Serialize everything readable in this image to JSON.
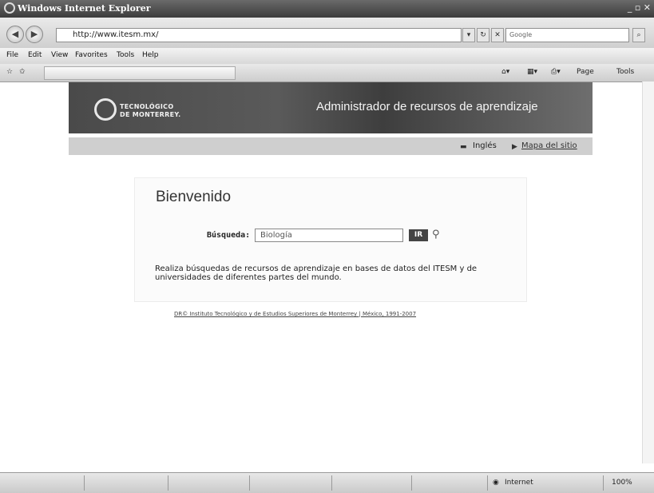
{
  "window": {
    "title": "Windows Internet Explorer"
  },
  "address": {
    "url": "http://www.itesm.mx/",
    "search_placeholder": "Google"
  },
  "menu": [
    "File",
    "Edit",
    "View",
    "Favorites",
    "Tools",
    "Help"
  ],
  "commandbar": {
    "page": "Page",
    "tools": "Tools"
  },
  "banner": {
    "logo_line1": "TECNOLÓGICO",
    "logo_line2": "DE MONTERREY.",
    "title": "Administrador de recursos de aprendizaje"
  },
  "subnav": {
    "ingles": "Inglés",
    "sitemap": "Mapa del sitio"
  },
  "main": {
    "heading": "Bienvenido",
    "search_label": "Búsqueda:",
    "search_value": "Biología",
    "go_button": "IR",
    "description": "Realiza búsquedas de recursos de aprendizaje en bases de datos del ITESM y de universidades de diferentes partes del mundo.",
    "footer": "DR© Instituto Tecnológico y de Estudios Superiores de Monterrey | México, 1991-2007"
  },
  "status": {
    "zone": "Internet",
    "zoom": "100%"
  }
}
